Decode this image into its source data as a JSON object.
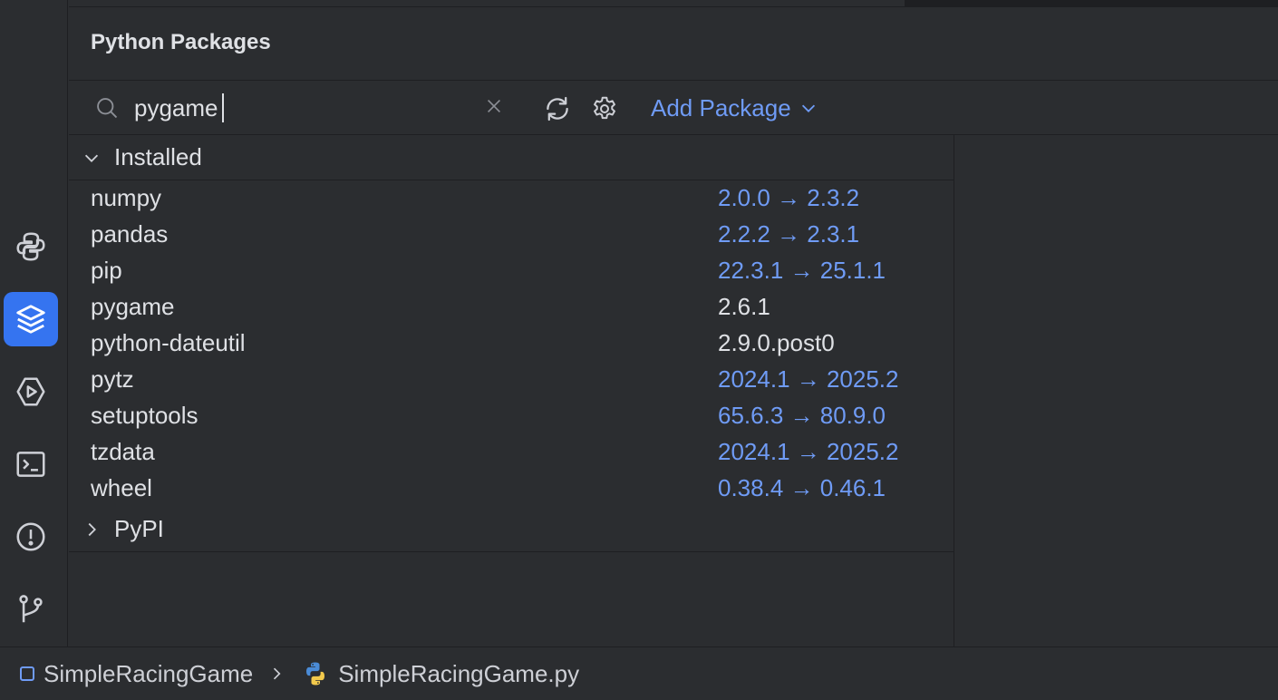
{
  "panel": {
    "title": "Python Packages"
  },
  "toolbar": {
    "search_value": "pygame",
    "search_icon": "search-icon",
    "clear_icon": "close-icon",
    "refresh_icon": "refresh-icon",
    "settings_icon": "gear-icon",
    "add_package_label": "Add Package"
  },
  "installed": {
    "label": "Installed",
    "expanded": true,
    "packages": [
      {
        "name": "numpy",
        "version": "2.0.0 → 2.3.2",
        "upgrade": true
      },
      {
        "name": "pandas",
        "version": "2.2.2 → 2.3.1",
        "upgrade": true
      },
      {
        "name": "pip",
        "version": "22.3.1 → 25.1.1",
        "upgrade": true
      },
      {
        "name": "pygame",
        "version": "2.6.1",
        "upgrade": false
      },
      {
        "name": "python-dateutil",
        "version": "2.9.0.post0",
        "upgrade": false
      },
      {
        "name": "pytz",
        "version": "2024.1 → 2025.2",
        "upgrade": true
      },
      {
        "name": "setuptools",
        "version": "65.6.3 → 80.9.0",
        "upgrade": true
      },
      {
        "name": "tzdata",
        "version": "2024.1 → 2025.2",
        "upgrade": true
      },
      {
        "name": "wheel",
        "version": "0.38.4 → 0.46.1",
        "upgrade": true
      }
    ]
  },
  "pypi": {
    "label": "PyPI",
    "expanded": false
  },
  "toolstrip": {
    "items": [
      "python-console-icon",
      "packages-icon",
      "services-icon",
      "terminal-icon",
      "problems-icon",
      "git-icon"
    ],
    "active": "packages-icon"
  },
  "statusbar": {
    "project": "SimpleRacingGame",
    "file": "SimpleRacingGame.py"
  },
  "colors": {
    "accent": "#3574f0",
    "link": "#6f9bf5",
    "background": "#2b2d30"
  }
}
